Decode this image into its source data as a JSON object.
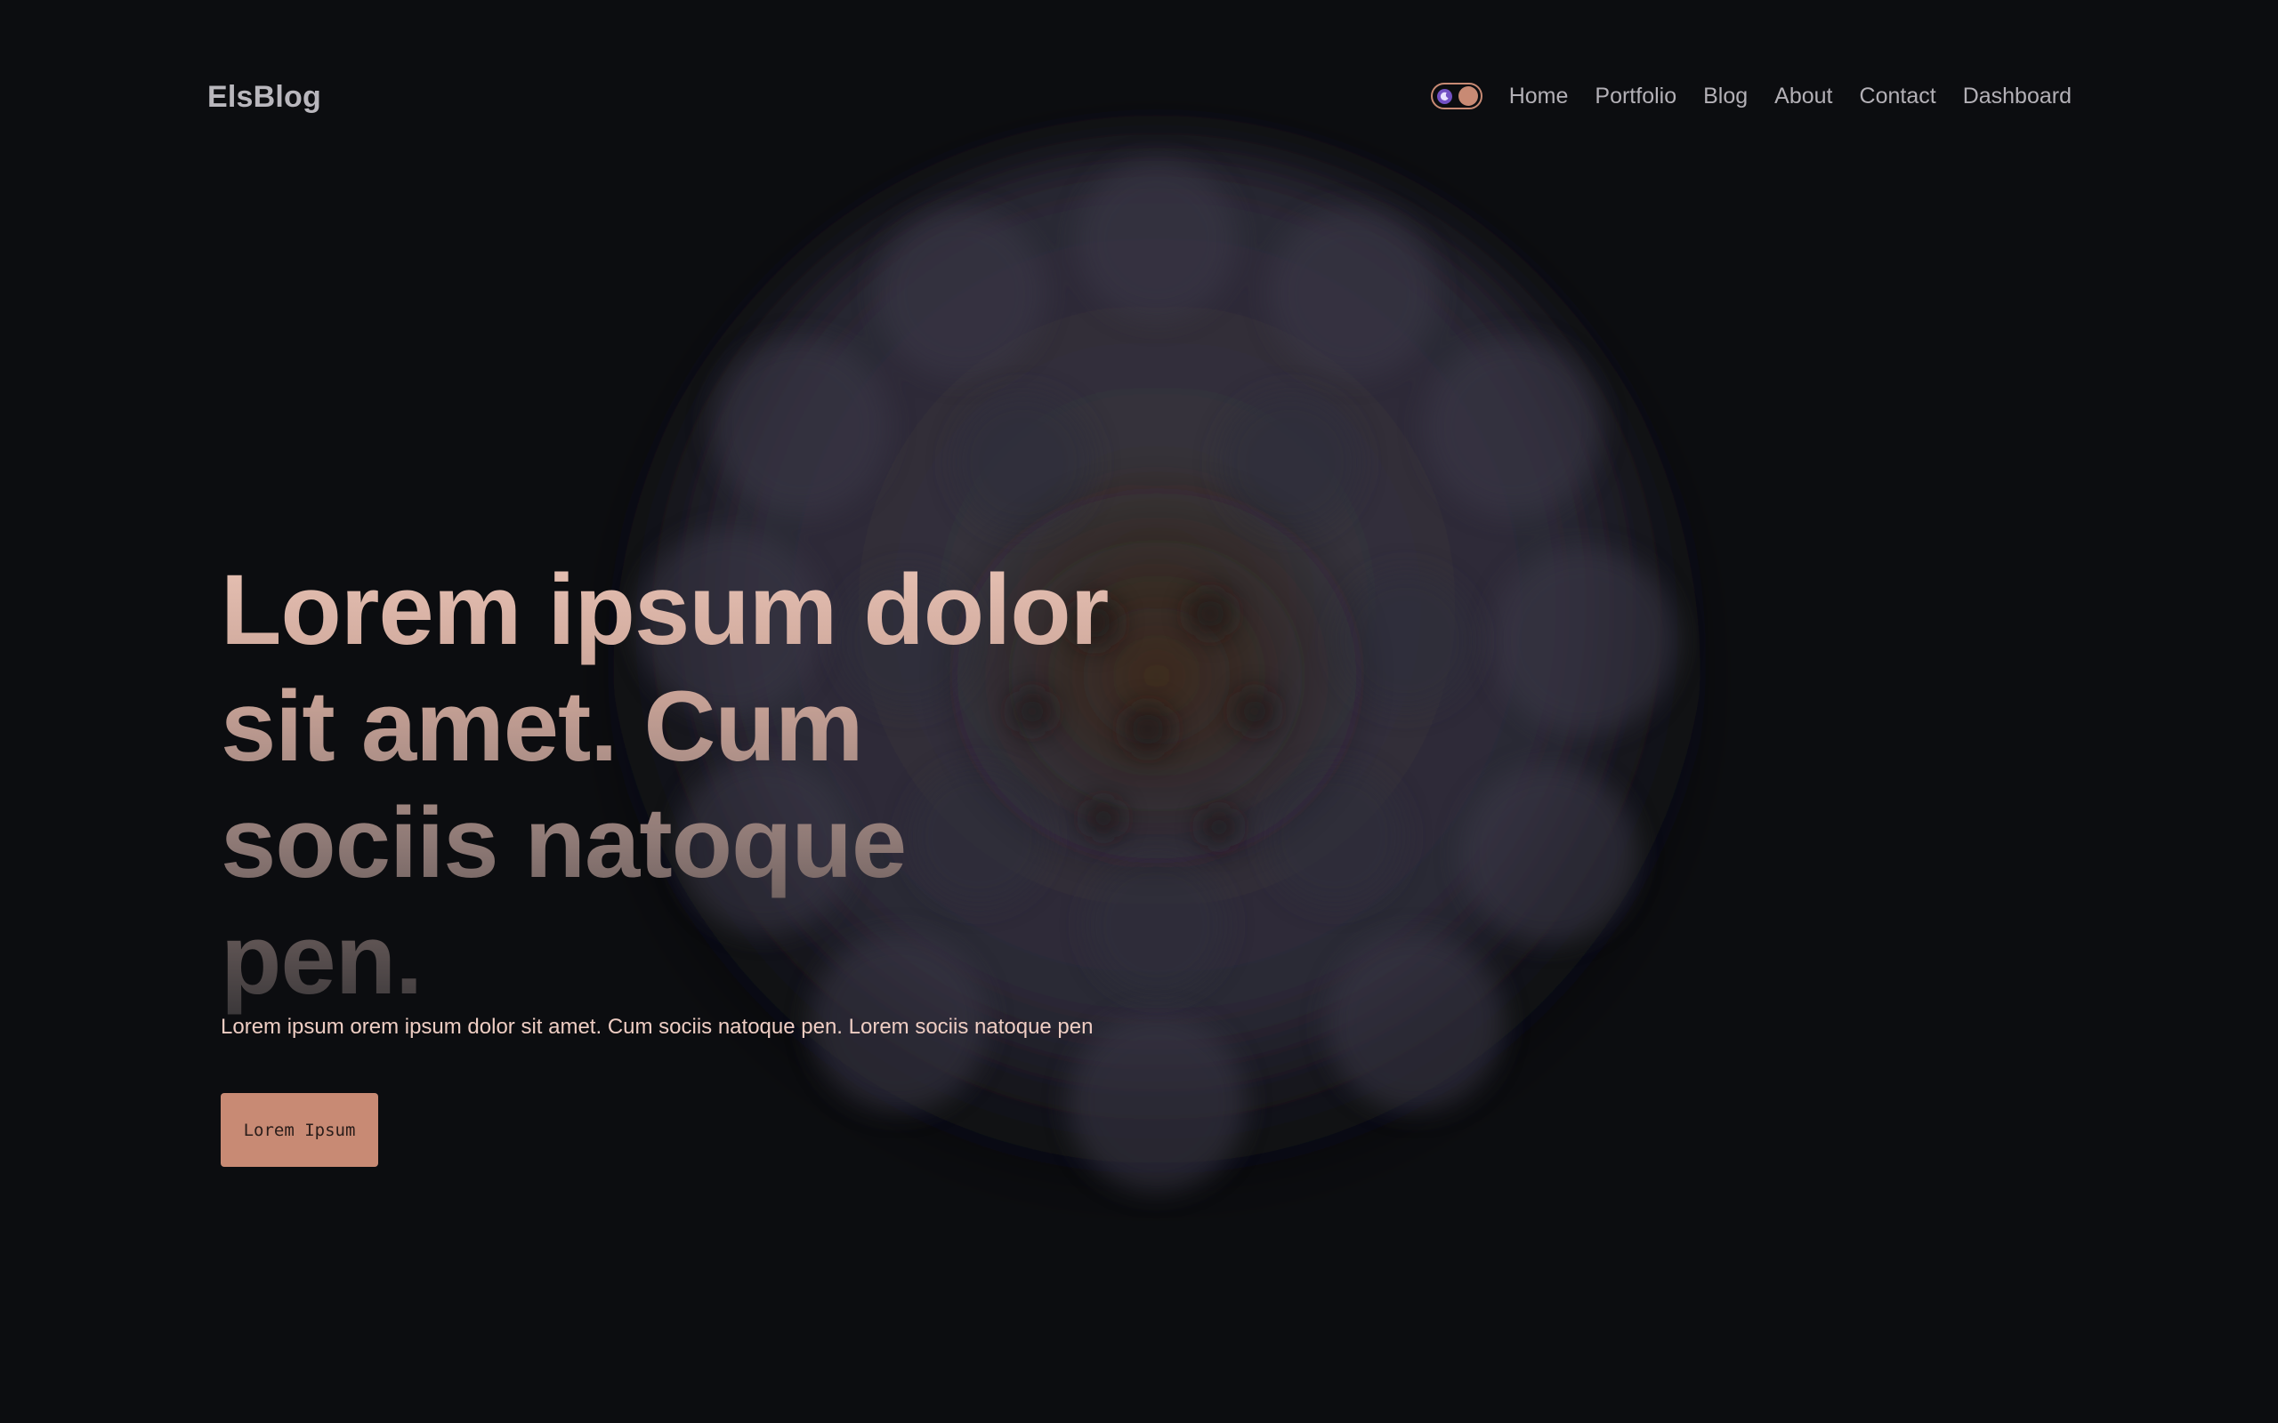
{
  "header": {
    "brand": "ElsBlog",
    "theme_toggle": {
      "state": "dark",
      "icon": "moon-icon"
    },
    "nav": [
      {
        "label": "Home"
      },
      {
        "label": "Portfolio"
      },
      {
        "label": "Blog"
      },
      {
        "label": "About"
      },
      {
        "label": "Contact"
      },
      {
        "label": "Dashboard"
      }
    ]
  },
  "hero": {
    "headline": "Lorem ipsum dolor sit amet. Cum sociis natoque pen.",
    "subtitle": "Lorem ipsum orem ipsum dolor sit amet. Cum sociis natoque pen. Lorem sociis natoque pen",
    "cta_label": "Lorem Ipsum"
  },
  "colors": {
    "background": "#0c0d10",
    "accent": "#c88a74",
    "brand_text": "#b9b7bd",
    "nav_text": "#b3b0b6",
    "subtitle_text": "#eecdc3",
    "toggle_moon": "#7351c4"
  }
}
